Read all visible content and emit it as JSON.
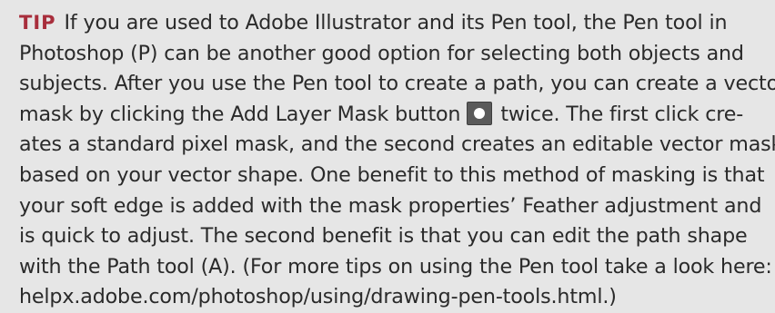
{
  "tip": {
    "label": "TIP",
    "lines": [
      "If you are used to Adobe Illustrator and its Pen tool, the Pen tool in",
      "Photoshop (P) can be another good option for selecting both objects and",
      "subjects. After you use the Pen tool to create a path, you can create a vector",
      "mask by clicking the Add Layer Mask button",
      "twice. The first click cre-",
      "ates a standard pixel mask, and the second creates an editable vector mask",
      "based on your vector shape. One benefit to this method of masking is that",
      "your soft edge is added with the mask properties’ Feather adjustment and",
      "is quick to adjust. The second benefit is that you can edit the path shape",
      "with the Path tool (A). (For more tips on using the Pen tool take a look here:",
      "helpx.adobe.com/photoshop/using/drawing-pen-tools.html.)"
    ]
  },
  "icons": {
    "add_layer_mask": "add-layer-mask-icon"
  },
  "colors": {
    "background": "#e6e6e6",
    "tip_label": "#a82e3c",
    "text": "#2a2a2a"
  }
}
